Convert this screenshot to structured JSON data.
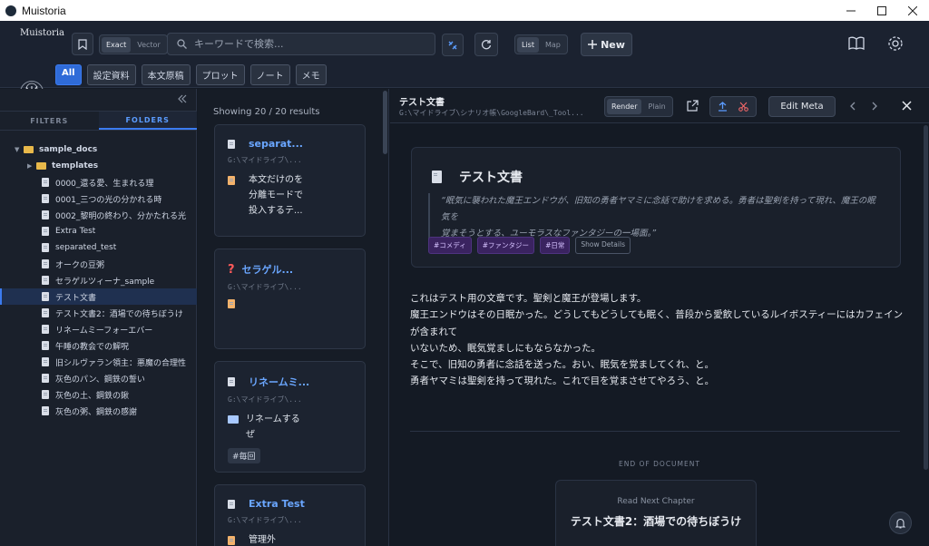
{
  "window": {
    "title": "Muistoria"
  },
  "header": {
    "logo_text": "Muistoria",
    "search_mode": [
      "Exact",
      "Vector"
    ],
    "search_placeholder": "キーワードで検索...",
    "view_mode": [
      "List",
      "Map"
    ],
    "new_label": "New",
    "chips": [
      "All",
      "設定資料",
      "本文原稿",
      "プロット",
      "ノート",
      "メモ"
    ]
  },
  "sidebar": {
    "tabs": [
      "FILTERS",
      "FOLDERS"
    ],
    "root": "sample_docs",
    "subfolder": "templates",
    "files": [
      "0000_還る愛、生まれる理",
      "0001_三つの光の分かれる時",
      "0002_黎明の終わり、分かたれる光",
      "Extra Test",
      "separated_test",
      "オークの豆粥",
      "セラゲルツィーナ_sample",
      "テスト文書",
      "テスト文書2：酒場での待ちぼうけ",
      "リネームミーフォーエバー",
      "午睡の教会での解呪",
      "旧シルヴァラン領主：悪魔の合理性",
      "灰色のパン、鋼鉄の誓い",
      "灰色の土、鋼鉄の鍬",
      "灰色の粥、鋼鉄の感謝"
    ]
  },
  "results": {
    "count_text": "Showing 20 / 20 results",
    "cards": [
      {
        "title": "separat...",
        "path": "G:\\マイドライブ\\...",
        "body1": "本文だけのを",
        "body2": "分離モードで",
        "body3": "投入するテ...",
        "tag": ""
      },
      {
        "title": "セラゲル...",
        "path": "G:\\マイドライブ\\...",
        "body1": "",
        "body2": "",
        "body3": "",
        "tag": ""
      },
      {
        "title": "リネームミ...",
        "path": "G:\\マイドライブ\\...",
        "body1": "リネームする",
        "body2": "ぜ",
        "body3": "",
        "tag": "#毎回"
      },
      {
        "title": "Extra Test",
        "path": "G:\\マイドライブ\\...",
        "body1": "管理外",
        "body2": "",
        "body3": "",
        "tag": ""
      }
    ]
  },
  "detail": {
    "title": "テスト文書",
    "path": "G:\\マイドライブ\\シナリオ帳\\GoogleBard\\_Tool...",
    "render_mode": [
      "Render",
      "Plain"
    ],
    "edit_meta": "Edit Meta",
    "doc_title": "テスト文書",
    "summary_line1": "“眠気に襲われた魔王エンドウが、旧知の勇者ヤマミに念話で助けを求める。勇者は聖剣を持って現れ、魔王の眠気を",
    "summary_line2": "覚まそうとする、ユーモラスなファンタジーの一場面。”",
    "tags": [
      "#コメディ",
      "#ファンタジー",
      "#日常"
    ],
    "show_details": "Show Details",
    "lines": [
      "これはテスト用の文章です。聖剣と魔王が登場します。",
      "魔王エンドウはその日眠かった。どうしてもどうしても眠く、普段から愛飲しているルイボスティーにはカフェインが含まれて",
      "いないため、眠気覚ましにもならなかった。",
      "そこで、旧知の勇者に念話を送った。おい、眠気を覚ましてくれ、と。",
      "勇者ヤマミは聖剣を持って現れた。これで目を覚まさせてやろう、と。"
    ],
    "end_label": "END OF DOCUMENT",
    "next_label": "Read Next Chapter",
    "next_title": "テスト文書2：酒場での待ちぼうけ"
  },
  "colors": {
    "accent": "#3b7bf0",
    "bg": "#141a24",
    "tag_purple": "#3a2360"
  }
}
